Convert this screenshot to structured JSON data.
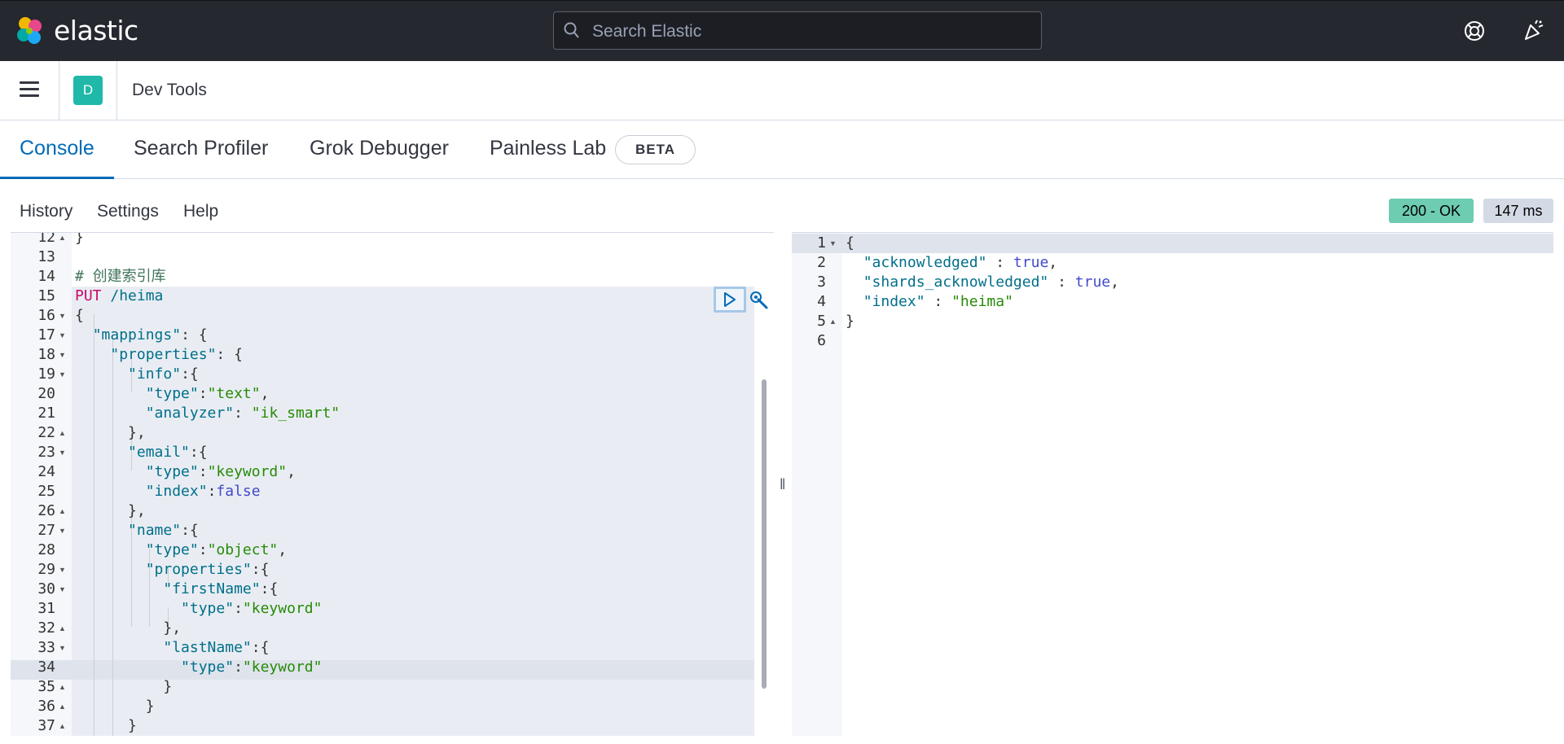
{
  "header": {
    "brand": "elastic",
    "search_placeholder": "Search Elastic"
  },
  "breadcrumb": {
    "space_initial": "D",
    "current": "Dev Tools"
  },
  "tabs": [
    {
      "label": "Console",
      "active": true
    },
    {
      "label": "Search Profiler",
      "active": false
    },
    {
      "label": "Grok Debugger",
      "active": false
    },
    {
      "label": "Painless Lab",
      "active": false
    }
  ],
  "beta_badge": "BETA",
  "toolbar": {
    "history": "History",
    "settings": "Settings",
    "help": "Help"
  },
  "response_status": {
    "code": "200 - OK",
    "time": "147 ms",
    "ok_color": "#6dccb1"
  },
  "request_editor": {
    "lines": [
      {
        "n": "12",
        "fold": "up",
        "text": "}"
      },
      {
        "n": "13",
        "fold": "",
        "text": ""
      },
      {
        "n": "14",
        "fold": "",
        "text": "# 创建索引库"
      },
      {
        "n": "15",
        "fold": "",
        "text": "PUT /heima"
      },
      {
        "n": "16",
        "fold": "down",
        "text": "{"
      },
      {
        "n": "17",
        "fold": "down",
        "text": "  \"mappings\": {"
      },
      {
        "n": "18",
        "fold": "down",
        "text": "    \"properties\": {"
      },
      {
        "n": "19",
        "fold": "down",
        "text": "      \"info\":{"
      },
      {
        "n": "20",
        "fold": "",
        "text": "        \"type\":\"text\","
      },
      {
        "n": "21",
        "fold": "",
        "text": "        \"analyzer\": \"ik_smart\""
      },
      {
        "n": "22",
        "fold": "up",
        "text": "      },"
      },
      {
        "n": "23",
        "fold": "down",
        "text": "      \"email\":{"
      },
      {
        "n": "24",
        "fold": "",
        "text": "        \"type\":\"keyword\","
      },
      {
        "n": "25",
        "fold": "",
        "text": "        \"index\":false"
      },
      {
        "n": "26",
        "fold": "up",
        "text": "      },"
      },
      {
        "n": "27",
        "fold": "down",
        "text": "      \"name\":{"
      },
      {
        "n": "28",
        "fold": "",
        "text": "        \"type\":\"object\","
      },
      {
        "n": "29",
        "fold": "down",
        "text": "        \"properties\":{"
      },
      {
        "n": "30",
        "fold": "down",
        "text": "          \"firstName\":{"
      },
      {
        "n": "31",
        "fold": "",
        "text": "            \"type\":\"keyword\""
      },
      {
        "n": "32",
        "fold": "up",
        "text": "          },"
      },
      {
        "n": "33",
        "fold": "down",
        "text": "          \"lastName\":{"
      },
      {
        "n": "34",
        "fold": "",
        "text": "            \"type\":\"keyword\""
      },
      {
        "n": "35",
        "fold": "up",
        "text": "          }"
      },
      {
        "n": "36",
        "fold": "up",
        "text": "        }"
      },
      {
        "n": "37",
        "fold": "up",
        "text": "      }"
      }
    ]
  },
  "response_editor": {
    "lines": [
      {
        "n": "1",
        "fold": "down",
        "text": "{"
      },
      {
        "n": "2",
        "fold": "",
        "text": "  \"acknowledged\" : true,"
      },
      {
        "n": "3",
        "fold": "",
        "text": "  \"shards_acknowledged\" : true,"
      },
      {
        "n": "4",
        "fold": "",
        "text": "  \"index\" : \"heima\""
      },
      {
        "n": "5",
        "fold": "up",
        "text": "}"
      },
      {
        "n": "6",
        "fold": "",
        "text": ""
      }
    ]
  },
  "icons": {
    "logo": "elastic-logo-icon",
    "search": "search-icon",
    "help": "help-lifebuoy-icon",
    "news": "newsfeed-icon",
    "menu": "hamburger-menu-icon",
    "run": "play-icon",
    "wrench": "wrench-icon"
  }
}
